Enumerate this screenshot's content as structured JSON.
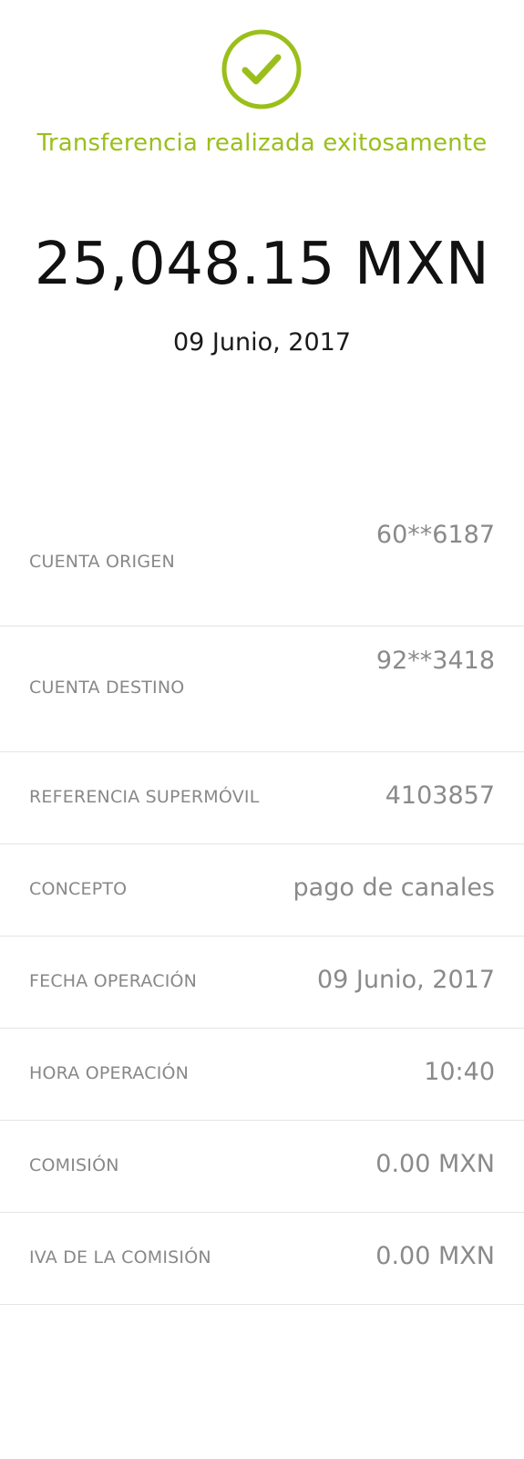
{
  "colors": {
    "accent": "#9bbf1a",
    "amount_text": "#111111",
    "label_text": "#888888",
    "value_text": "#8a8a8a",
    "divider": "#e4e4e4"
  },
  "header": {
    "icon": "check-circle-icon",
    "message": "Transferencia realizada exitosamente",
    "amount": "25,048.15 MXN",
    "date": "09 Junio, 2017"
  },
  "details": [
    {
      "label": "CUENTA ORIGEN",
      "value": "60**6187"
    },
    {
      "label": "CUENTA DESTINO",
      "value": "92**3418"
    },
    {
      "label": "REFERENCIA SUPERMÓVIL",
      "value": "4103857"
    },
    {
      "label": "CONCEPTO",
      "value": "pago de canales"
    },
    {
      "label": "FECHA OPERACIÓN",
      "value": "09 Junio, 2017"
    },
    {
      "label": "HORA OPERACIÓN",
      "value": "10:40"
    },
    {
      "label": "COMISIÓN",
      "value": "0.00 MXN"
    },
    {
      "label": "IVA DE LA COMISIÓN",
      "value": "0.00 MXN"
    }
  ]
}
